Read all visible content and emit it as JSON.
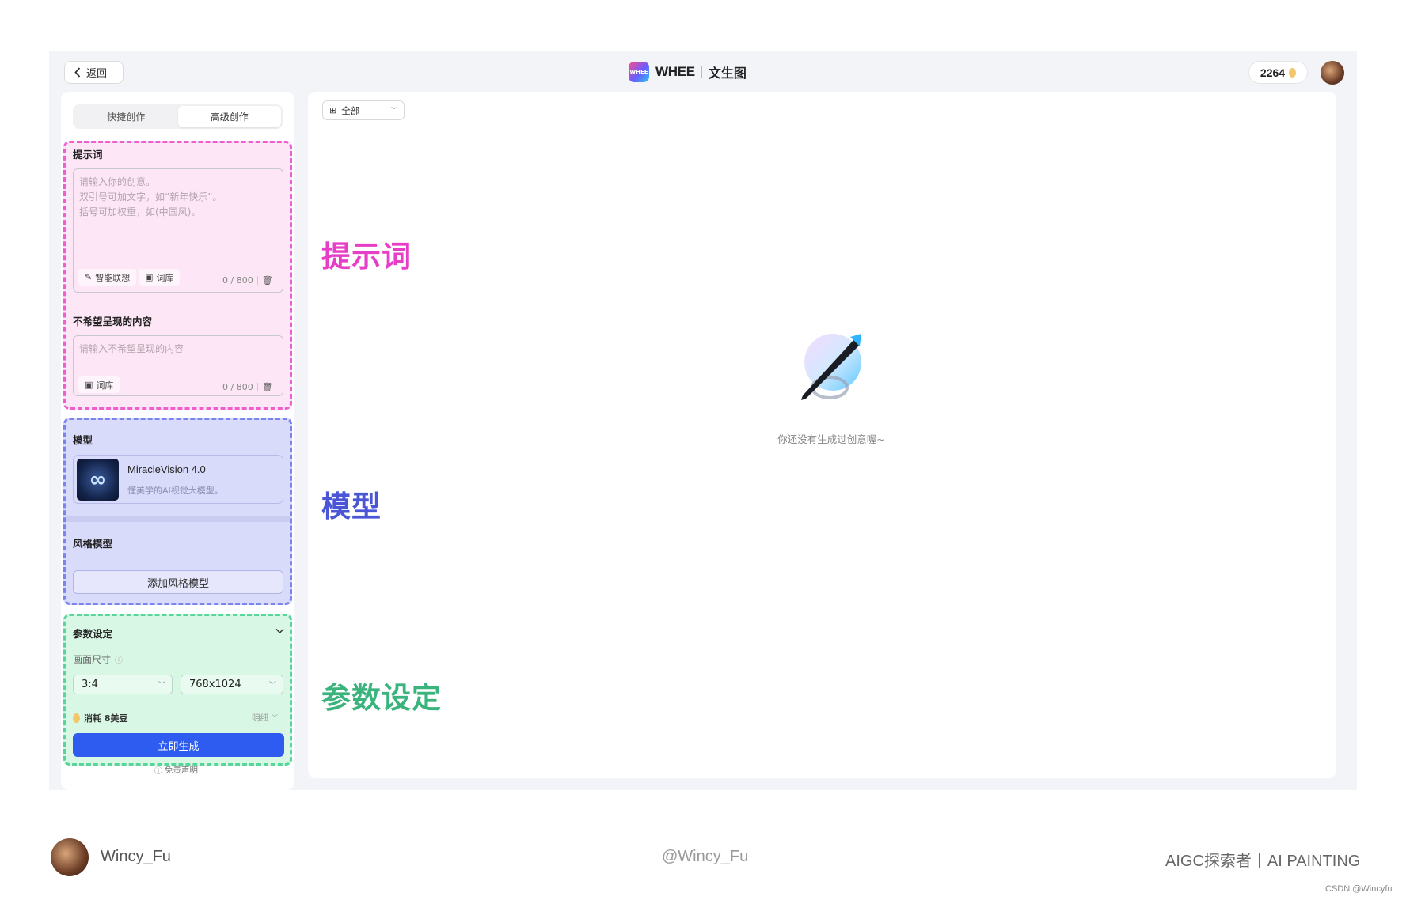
{
  "header": {
    "back_label": "返回",
    "brand_mark": "WHEE",
    "brand_name": "WHEE",
    "page_title": "文生图",
    "credits": "2264"
  },
  "tabs": [
    {
      "label": "快捷创作",
      "active": false
    },
    {
      "label": "高级创作",
      "active": true
    }
  ],
  "prompt": {
    "label": "提示词",
    "placeholder": "请输入你的创意。\n双引号可加文字，如“新年快乐”。\n括号可加权重，如(中国风)。",
    "smart_label": "智能联想",
    "library_label": "词库",
    "counter": "0 / 800"
  },
  "negative": {
    "label": "不希望呈现的内容",
    "placeholder": "请输入不希望呈现的内容",
    "library_label": "词库",
    "counter": "0 / 800"
  },
  "model": {
    "label": "模型",
    "name": "MiracleVision 4.0",
    "desc": "懂美学的AI视觉大模型。"
  },
  "style_model": {
    "label": "风格模型",
    "add_label": "添加风格模型"
  },
  "params": {
    "label": "参数设定",
    "size_label": "画面尺寸",
    "ratio": "3:4",
    "resolution": "768x1024",
    "cost": "消耗 8美豆",
    "detail": "明细",
    "generate": "立即生成",
    "disclaimer": "免责声明"
  },
  "canvas": {
    "filter": "全部",
    "empty_text": "你还没有生成过创意喔~"
  },
  "annotations": {
    "prompt": "提示词",
    "model": "模型",
    "params": "参数设定"
  },
  "footer": {
    "author": "Wincy_Fu",
    "handle": "@Wincy_Fu",
    "tagline": "AIGC探索者丨AI PAINTING",
    "watermark": "CSDN @Wincyfu"
  },
  "colors": {
    "prompt_zone": "#fde7f6",
    "prompt_border": "#ee5ed0",
    "model_zone": "#d9dbfb",
    "model_border": "#7b84ee",
    "params_zone": "#d8f7e4",
    "params_border": "#59d49a",
    "primary": "#2f5cf0",
    "anno_prompt": "#e63ec6",
    "anno_model": "#4a56d6",
    "anno_params": "#3ab37c"
  }
}
